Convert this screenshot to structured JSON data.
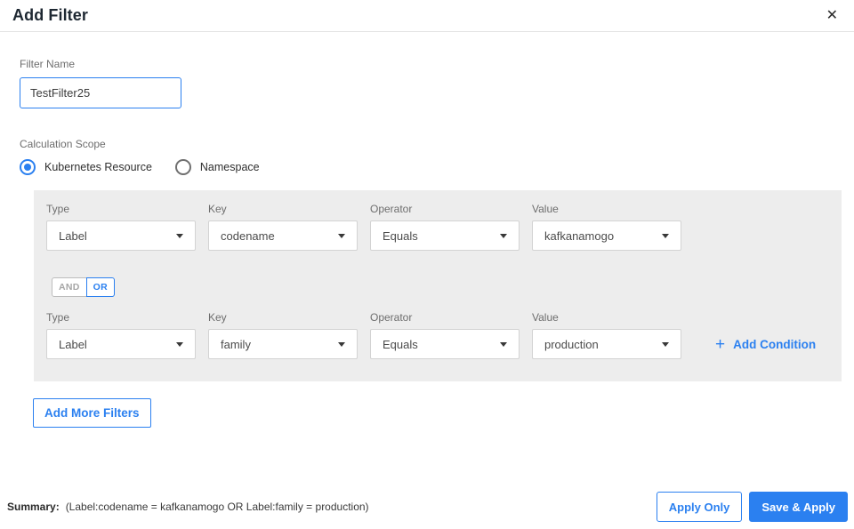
{
  "colors": {
    "accent": "#2b80f0",
    "panel-bg": "#ededed",
    "title": "#1e2832",
    "label": "#6e6e6e",
    "text": "#4b4b4b",
    "border": "#d3d3d3"
  },
  "header": {
    "title": "Add Filter",
    "close_icon": "✕"
  },
  "filter_name": {
    "label": "Filter Name",
    "value": "TestFilter25"
  },
  "calculation_scope": {
    "label": "Calculation Scope",
    "options": [
      {
        "label": "Kubernetes Resource",
        "selected": true
      },
      {
        "label": "Namespace",
        "selected": false
      }
    ]
  },
  "conditions": {
    "column_labels": {
      "type": "Type",
      "key": "Key",
      "operator": "Operator",
      "value": "Value"
    },
    "rows": [
      {
        "type": "Label",
        "key": "codename",
        "operator": "Equals",
        "value": "kafkanamogo"
      },
      {
        "type": "Label",
        "key": "family",
        "operator": "Equals",
        "value": "production"
      }
    ],
    "combinator": {
      "and": "AND",
      "or": "OR",
      "selected": "OR"
    },
    "add_condition": {
      "plus_icon": "+",
      "label": "Add Condition"
    }
  },
  "add_more_filters": {
    "label": "Add More Filters"
  },
  "footer": {
    "summary_label": "Summary:",
    "summary_text": "(Label:codename = kafkanamogo OR Label:family = production)",
    "buttons": [
      {
        "label": "Apply Only",
        "style": "outline"
      },
      {
        "label": "Save & Apply",
        "style": "primary"
      }
    ]
  }
}
